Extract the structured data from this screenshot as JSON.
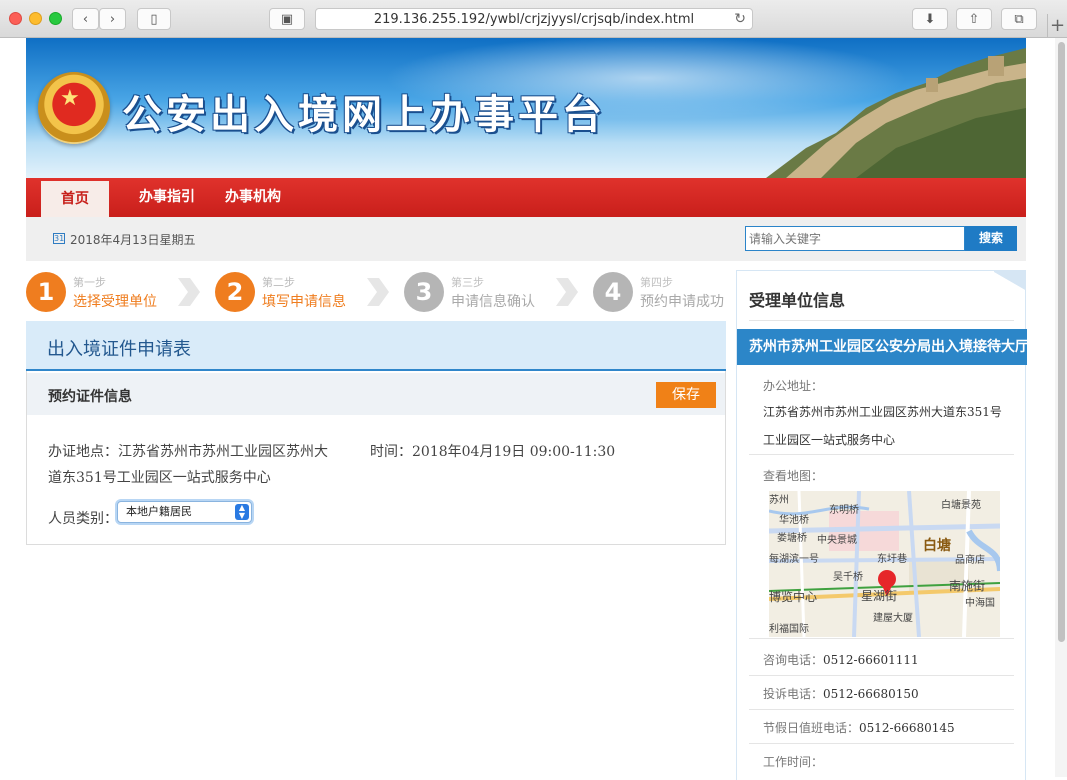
{
  "browser": {
    "url": "219.136.255.192/ywbl/crjzjyysl/crjsqb/index.html"
  },
  "banner": {
    "title": "公安出入境网上办事平台"
  },
  "nav": {
    "items": [
      "首页",
      "办事指引",
      "办事机构"
    ]
  },
  "datebar": {
    "date": "2018年4月13日星期五",
    "search_placeholder": "请输入关键字",
    "search_button": "搜索"
  },
  "steps": [
    {
      "num": "1",
      "small": "第一步",
      "big": "选择受理单位",
      "state": "done"
    },
    {
      "num": "2",
      "small": "第二步",
      "big": "填写申请信息",
      "state": "active"
    },
    {
      "num": "3",
      "small": "第三步",
      "big": "申请信息确认",
      "state": "pending"
    },
    {
      "num": "4",
      "small": "第四步",
      "big": "预约申请成功",
      "state": "pending"
    }
  ],
  "form": {
    "title": "出入境证件申请表",
    "section_title": "预约证件信息",
    "save_label": "保存",
    "address": "办证地点：江苏省苏州市苏州工业园区苏州大道东351号工业园区一站式服务中心",
    "time": "时间：2018年04月19日 09:00-11:30",
    "person_type_label": "人员类别：",
    "person_type_value": "本地户籍居民"
  },
  "panel": {
    "title": "受理单位信息",
    "unit_name": "苏州市苏州工业园区公安分局出入境接待大厅",
    "office_address_label": "办公地址：",
    "office_address": "江苏省苏州市苏州工业园区苏州大道东351号工业园区一站式服务中心",
    "map_label": "查看地图：",
    "map_labels": [
      "苏州",
      "东明桥",
      "白塘景苑",
      "华池桥",
      "娄塘桥",
      "中央景城",
      "白塘",
      "每湖滨一号",
      "东圩巷",
      "品商店",
      "吴千桥",
      "南施街",
      "博览中心",
      "星湖街",
      "中海国",
      "建屋大厦",
      "利福国际"
    ],
    "consult_phone_label": "咨询电话：",
    "consult_phone": "0512-66601111",
    "complaint_phone_label": "投诉电话：",
    "complaint_phone": "0512-66680150",
    "holiday_phone_label": "节假日值班电话：",
    "holiday_phone": "0512-66680145",
    "work_time_label": "工作时间："
  },
  "colors": {
    "nav_red": "#c91f1b",
    "step_orange": "#ef7d1f",
    "accent_blue": "#2c86c8",
    "save_orange": "#f08117"
  }
}
